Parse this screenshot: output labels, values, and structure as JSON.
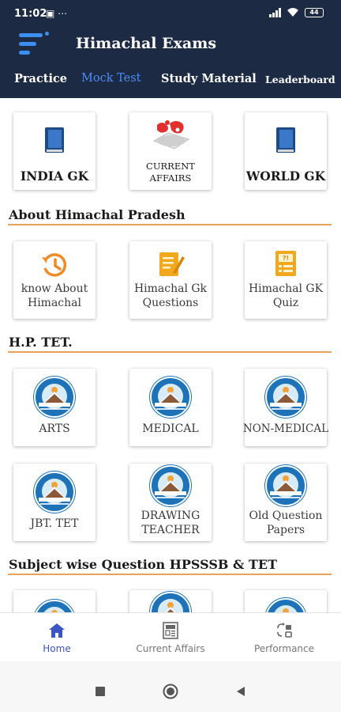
{
  "status_bar": {
    "time": "11:02",
    "extra": "▣ ⋯",
    "battery": "44"
  },
  "header": {
    "title": "Himachal Exams",
    "tabs": [
      {
        "label": "Practice",
        "active": false
      },
      {
        "label": "Mock Test",
        "active": true
      },
      {
        "label": "Study Material",
        "active": false
      },
      {
        "label": "Leaderboard",
        "active": false
      }
    ]
  },
  "top_cards": [
    {
      "label": "INDIA GK",
      "icon": "book-icon"
    },
    {
      "label": "CURRENT AFFAIRS",
      "line1": "CURRENT",
      "line2": "AFFAIRS",
      "icon": "world-map-icon"
    },
    {
      "label": "WORLD GK",
      "icon": "book-icon"
    }
  ],
  "sections": [
    {
      "title": "About Himachal Pradesh",
      "cards": [
        {
          "line1": "know About",
          "line2": "Himachal",
          "icon": "history-icon"
        },
        {
          "line1": "Himachal Gk",
          "line2": "Questions",
          "icon": "notepad-icon"
        },
        {
          "line1": "Himachal GK",
          "line2": "Quiz",
          "icon": "quiz-icon"
        }
      ]
    },
    {
      "title": "H.P. TET.",
      "cards": [
        {
          "line1": "ARTS",
          "icon": "hp-emblem-icon"
        },
        {
          "line1": "MEDICAL",
          "icon": "hp-emblem-icon"
        },
        {
          "line1": "NON-MEDICAL",
          "icon": "hp-emblem-icon"
        },
        {
          "line1": "JBT. TET",
          "icon": "hp-emblem-icon"
        },
        {
          "line1": "DRAWING",
          "line2": "TEACHER",
          "icon": "hp-emblem-icon"
        },
        {
          "line1": "Old Question",
          "line2": "Papers",
          "icon": "hp-emblem-icon"
        }
      ]
    },
    {
      "title": "Subject wise Question HPSSSB & TET",
      "cards": []
    }
  ],
  "bottom_nav": [
    {
      "label": "Home",
      "icon": "home-icon",
      "active": true
    },
    {
      "label": "Current Affairs",
      "icon": "newspaper-icon",
      "active": false
    },
    {
      "label": "Performance",
      "icon": "performance-icon",
      "active": false
    }
  ],
  "colors": {
    "header_bg": "#1d2a44",
    "accent_blue": "#4d8ef8",
    "section_line": "#e8a25a",
    "emblem_blue": "#1e73b8",
    "icon_orange": "#f08a24"
  }
}
